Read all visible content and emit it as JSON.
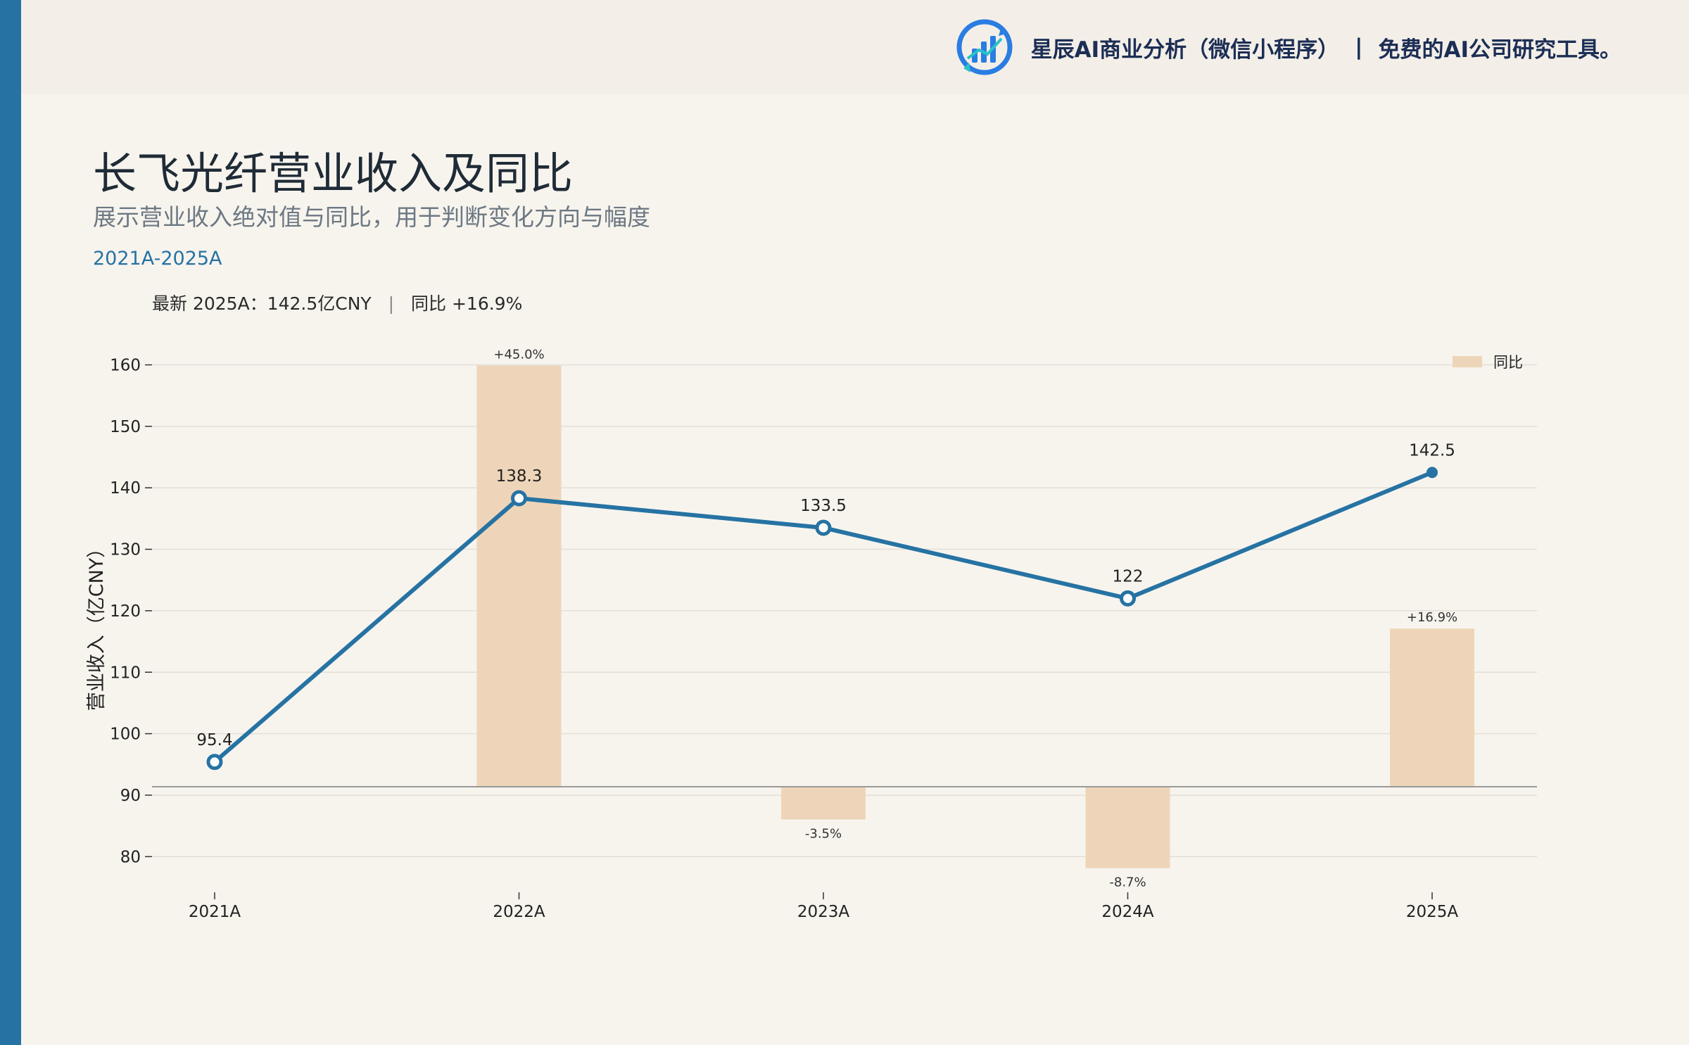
{
  "header": {
    "brand_name": "星辰AI商业分析（微信小程序）",
    "brand_separator": "|",
    "brand_tagline": "免费的AI公司研究工具。",
    "logo_icon": "bar-chart-logo-icon"
  },
  "title": "长飞光纤营业收入及同比",
  "subtitle": "展示营业收入绝对值与同比，用于判断变化方向与幅度",
  "period": "2021A-2025A",
  "summary": {
    "latest": "最新 2025A：142.5亿CNY",
    "separator": "|",
    "yoy": "同比 +16.9%"
  },
  "colors": {
    "line": "#2673a3",
    "bar": "#eed5b9",
    "accent": "#2673a3",
    "background": "#f7f4ee"
  },
  "chart_data": {
    "type": "line",
    "categories": [
      "2021A",
      "2022A",
      "2023A",
      "2024A",
      "2025A"
    ],
    "ylabel": "营业收入（亿CNY）",
    "ylim": [
      75,
      162
    ],
    "yticks": [
      80,
      90,
      100,
      110,
      120,
      130,
      140,
      150,
      160
    ],
    "grid": true,
    "legend": {
      "position": "top-right",
      "entries": [
        "同比"
      ]
    },
    "series": [
      {
        "type": "line",
        "values": [
          95.4,
          138.3,
          133.5,
          122,
          142.5
        ],
        "labels": [
          "95.4",
          "138.3",
          "133.5",
          "122",
          "142.5"
        ]
      },
      {
        "name": "同比",
        "type": "bar",
        "values": [
          null,
          45.0,
          -3.5,
          -8.7,
          16.9
        ],
        "labels": [
          "",
          "+45.0%",
          "-3.5%",
          "-8.7%",
          "+16.9%"
        ]
      }
    ]
  }
}
